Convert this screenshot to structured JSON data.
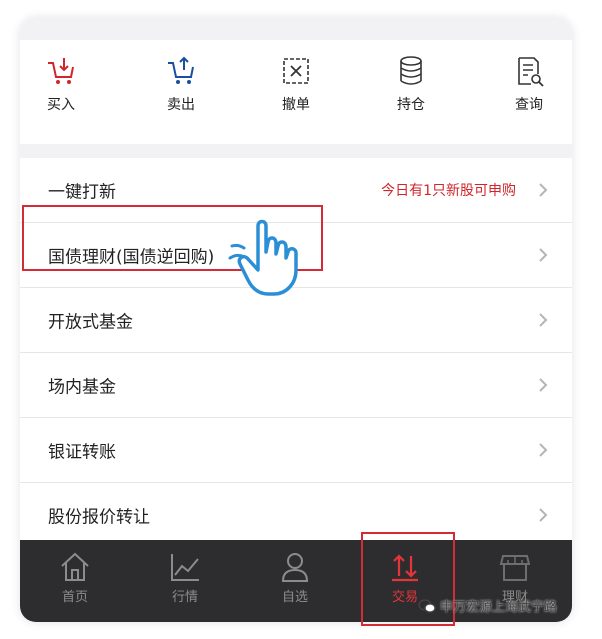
{
  "quick_actions": [
    {
      "label": "买入",
      "icon": "cart-down-icon"
    },
    {
      "label": "卖出",
      "icon": "cart-up-icon"
    },
    {
      "label": "撤单",
      "icon": "cancel-order-icon"
    },
    {
      "label": "持仓",
      "icon": "database-icon"
    },
    {
      "label": "查询",
      "icon": "document-search-icon"
    }
  ],
  "menu": {
    "items": [
      {
        "label": "一键打新",
        "note": "今日有1只新股可申购"
      },
      {
        "label": "国债理财(国债逆回购)"
      },
      {
        "label": "开放式基金"
      },
      {
        "label": "场内基金"
      },
      {
        "label": "银证转账"
      },
      {
        "label": "股份报价转让"
      }
    ]
  },
  "tabs": [
    {
      "label": "首页",
      "icon": "home-icon"
    },
    {
      "label": "行情",
      "icon": "chart-line-icon"
    },
    {
      "label": "自选",
      "icon": "user-icon"
    },
    {
      "label": "交易",
      "icon": "trade-arrows-icon",
      "active": true
    },
    {
      "label": "理财",
      "icon": "store-icon"
    }
  ],
  "watermark": {
    "text": "申万宏源上海武宁路"
  },
  "colors": {
    "accent": "#d0262b",
    "tabbar_bg": "#2d2d2f",
    "icon_blue": "#1a4fa0",
    "hand_blue": "#2b8fd6"
  }
}
